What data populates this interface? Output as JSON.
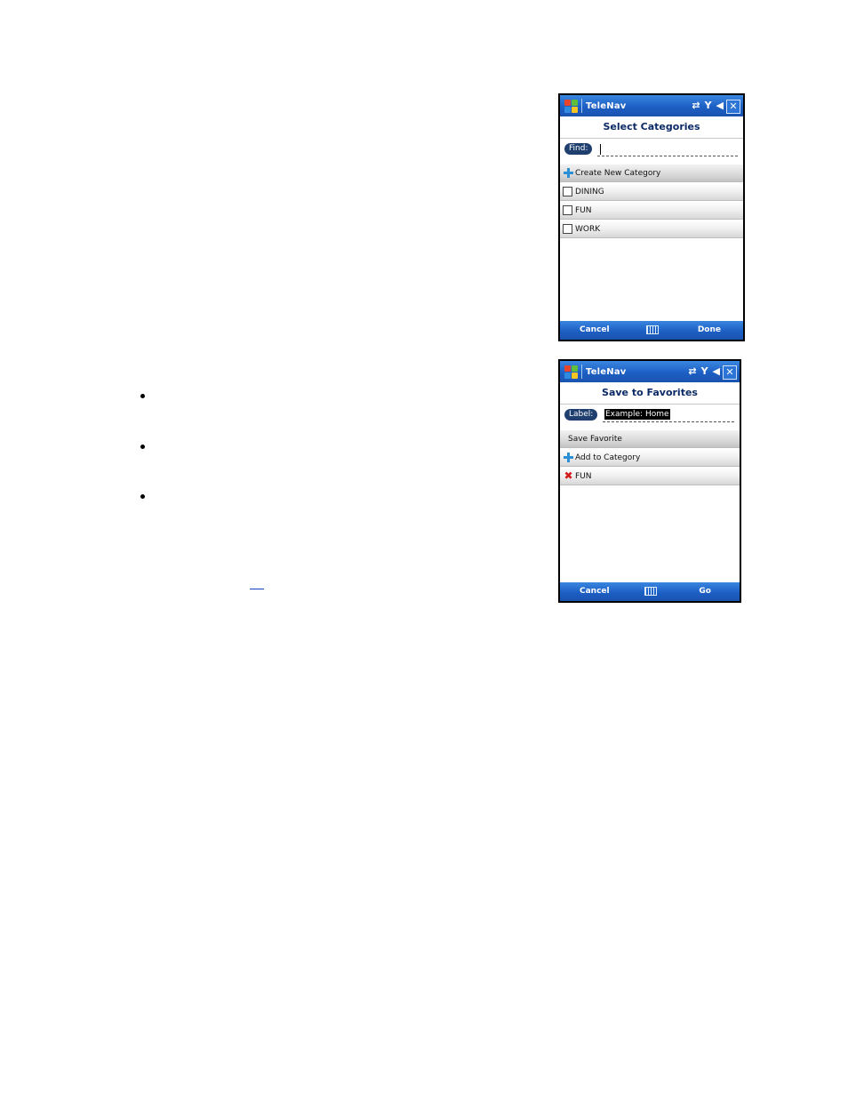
{
  "screens": [
    {
      "app_title": "TeleNav",
      "status_icons": [
        "sync-icon",
        "signal-icon",
        "volume-icon"
      ],
      "screen_title": "Select Categories",
      "field_label": "Find:",
      "field_value": "",
      "items": [
        {
          "label": "Create New Category",
          "icon": "plus-icon"
        },
        {
          "label": "DINING",
          "icon": "checkbox"
        },
        {
          "label": "FUN",
          "icon": "checkbox"
        },
        {
          "label": "WORK",
          "icon": "checkbox"
        }
      ],
      "softkey_left": "Cancel",
      "softkey_right": "Done"
    },
    {
      "app_title": "TeleNav",
      "status_icons": [
        "sync-icon",
        "signal-icon",
        "volume-icon"
      ],
      "screen_title": "Save to Favorites",
      "field_label": "Label:",
      "field_value": "Example: Home",
      "items": [
        {
          "label": "Save Favorite",
          "icon": "none"
        },
        {
          "label": "Add to Category",
          "icon": "plus-icon"
        },
        {
          "label": "FUN",
          "icon": "remove-icon"
        }
      ],
      "softkey_left": "Cancel",
      "softkey_right": "Go"
    }
  ],
  "colors": {
    "titlebar": "#1d5fc4",
    "label_pill": "#1f3f6e",
    "screen_title_text": "#0b2a66",
    "link": "#1a3fd0",
    "remove_icon": "#d21b1b",
    "plus_icon": "#2b8fd6"
  },
  "bullets_count": 3
}
